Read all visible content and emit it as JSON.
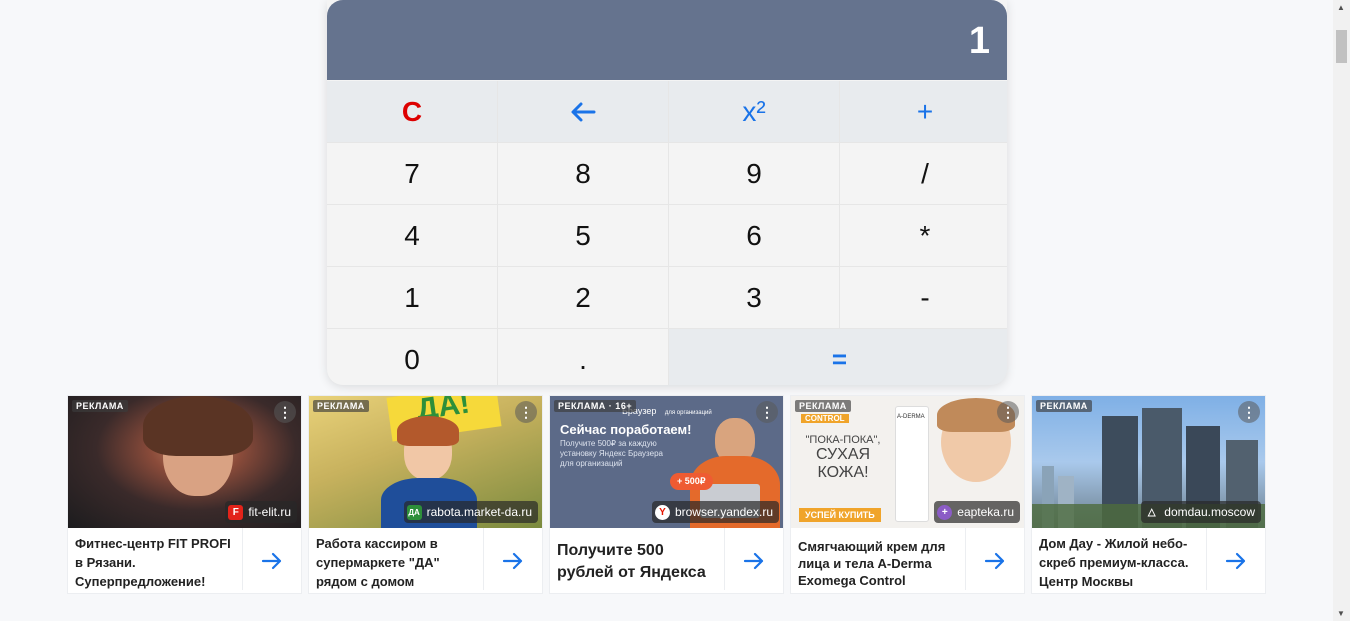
{
  "calculator": {
    "display": "1",
    "keys": {
      "clear": "C",
      "backspace": "←",
      "square": "x²",
      "plus": "+",
      "seven": "7",
      "eight": "8",
      "nine": "9",
      "divide": "/",
      "four": "4",
      "five": "5",
      "six": "6",
      "multiply": "*",
      "one": "1",
      "two": "2",
      "three": "3",
      "minus": "-",
      "zero": "0",
      "dot": ".",
      "equals": "="
    }
  },
  "ads": [
    {
      "tag": "РЕКЛАМА",
      "domain": "fit-elit.ru",
      "text": "Фитнес-центр FIT PROFI в Рязани. Суперпредложение!"
    },
    {
      "tag": "РЕКЛАМА",
      "domain": "rabota.market-da.ru",
      "text": "Работа кассиром в супермаркете \"ДА\" рядом с домом",
      "image_text": "ДА!"
    },
    {
      "tag": "РЕКЛАМА · 16+",
      "domain": "browser.yandex.ru",
      "text": "Получите 500 рублей от Яндекса",
      "image_header": "Браузер",
      "image_sub": "для организаций",
      "image_title": "Сейчас поработаем!",
      "image_body": "Получите 500₽ за каждую установку Яндекс Браузера для организаций",
      "image_badge": "+ 500₽"
    },
    {
      "tag": "РЕКЛАМА",
      "domain": "eapteka.ru",
      "text": "Смягчающий крем для лица и тела A-Derma Exomega Control",
      "image_brand": "A-DERMA",
      "image_line1": "\"ПОКА-ПОКА\",",
      "image_line2": "СУХАЯ",
      "image_line3": "КОЖА!",
      "image_button": "УСПЕЙ КУПИТЬ",
      "image_control": "CONTROL"
    },
    {
      "tag": "РЕКЛАМА",
      "domain": "domdau.moscow",
      "text": "Дом Дау - Жилой небо-скреб премиум-класса. Центр Москвы"
    }
  ],
  "colors": {
    "display_bg": "#65738e",
    "accent": "#1a73e8",
    "clear": "#dd0000"
  }
}
